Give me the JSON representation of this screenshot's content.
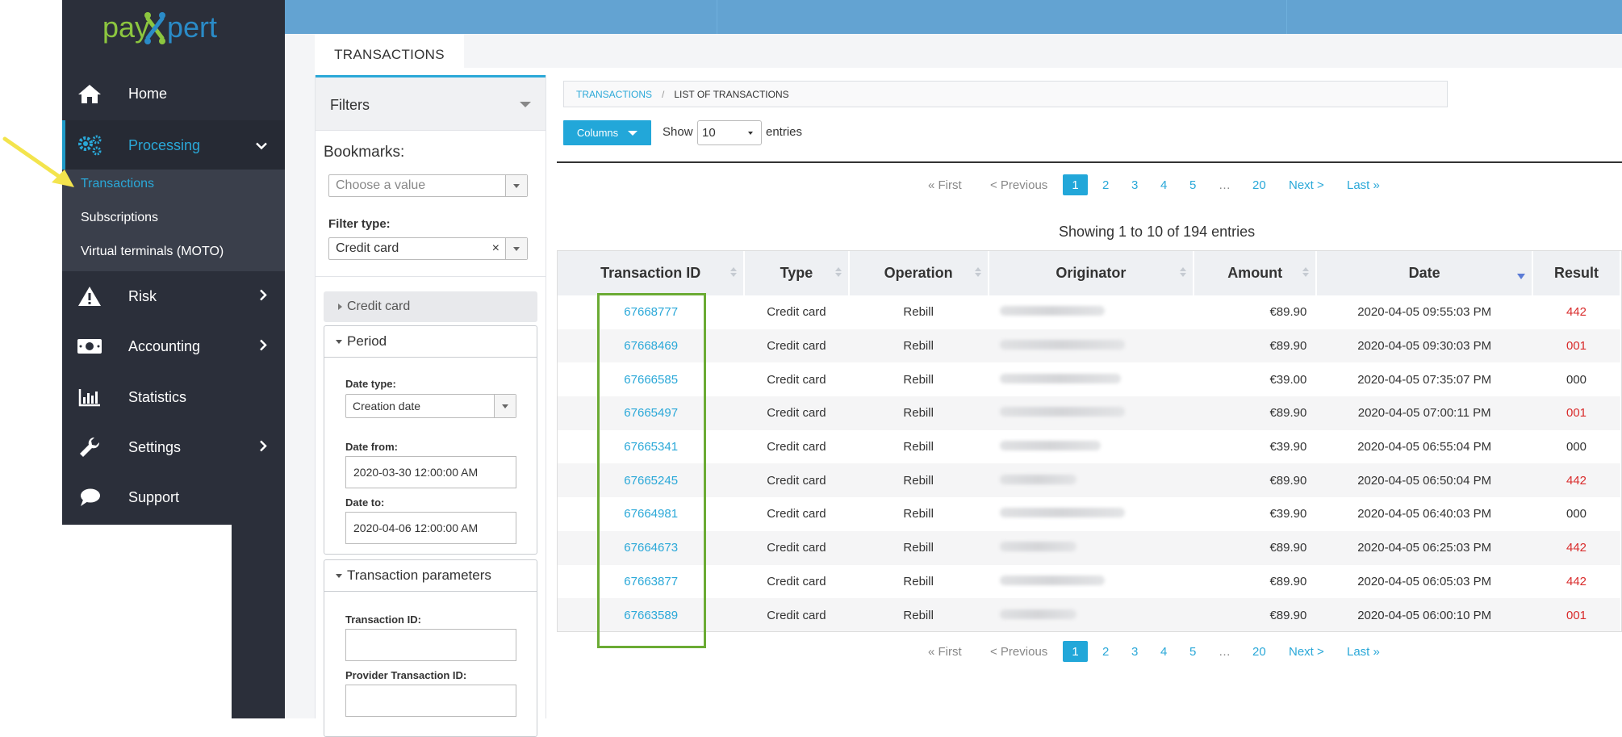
{
  "app": {
    "logo_text_left": "pay",
    "logo_text_right": "pert",
    "brand_colors": {
      "sidebar": "#2b2f3a",
      "accent": "#2aa8d8",
      "logo_blue": "#2a8bc7",
      "logo_green": "#8cc63f",
      "topbar": "#63a3d2"
    }
  },
  "sidebar": {
    "items": [
      {
        "label": "Home",
        "icon": "home-icon"
      },
      {
        "label": "Processing",
        "icon": "gears-icon",
        "expanded": true
      },
      {
        "label": "Risk",
        "icon": "warning-icon"
      },
      {
        "label": "Accounting",
        "icon": "money-icon"
      },
      {
        "label": "Statistics",
        "icon": "bar-chart-icon"
      },
      {
        "label": "Settings",
        "icon": "wrench-icon"
      },
      {
        "label": "Support",
        "icon": "chat-bubble-icon"
      }
    ],
    "sub_items": [
      {
        "label": "Transactions",
        "selected": true
      },
      {
        "label": "Subscriptions"
      },
      {
        "label": "Virtual terminals (MOTO)"
      }
    ]
  },
  "page": {
    "tab_title": "TRANSACTIONS"
  },
  "filters": {
    "title": "Filters",
    "bookmarks_label": "Bookmarks:",
    "bookmarks_placeholder": "Choose a value",
    "filter_type_label": "Filter type:",
    "filter_type_value": "Credit card",
    "credit_card_section": "Credit card",
    "period": {
      "title": "Period",
      "date_type_label": "Date type:",
      "date_type_value": "Creation date",
      "date_from_label": "Date from:",
      "date_from_value": "2020-03-30 12:00:00 AM",
      "date_to_label": "Date to:",
      "date_to_value": "2020-04-06 12:00:00 AM"
    },
    "transaction_parameters": {
      "title": "Transaction parameters",
      "transaction_id_label": "Transaction ID:",
      "transaction_id_value": "",
      "provider_transaction_id_label": "Provider Transaction ID:",
      "provider_transaction_id_value": ""
    }
  },
  "breadcrumb": {
    "link": "TRANSACTIONS",
    "separator": "/",
    "current": "LIST OF TRANSACTIONS"
  },
  "toolbar": {
    "columns_label": "Columns",
    "show_label": "Show",
    "page_size": "10",
    "entries_label": "entries"
  },
  "pagination": {
    "first": "« First",
    "previous": "< Previous",
    "pages": [
      "1",
      "2",
      "3",
      "4",
      "5"
    ],
    "active_page": "1",
    "ellipsis": "…",
    "last_page": "20",
    "next": "Next >",
    "last": "Last »"
  },
  "summary": {
    "text": "Showing 1 to 10 of 194 entries"
  },
  "table": {
    "headers": [
      "Transaction ID",
      "Type",
      "Operation",
      "Originator",
      "Amount",
      "Date",
      "Result"
    ],
    "rows": [
      {
        "id": "67668777",
        "type": "Credit card",
        "operation": "Rebill",
        "amount": "€89.90",
        "date": "2020-04-05 09:55:03 PM",
        "result": "442",
        "result_color": "red"
      },
      {
        "id": "67668469",
        "type": "Credit card",
        "operation": "Rebill",
        "amount": "€89.90",
        "date": "2020-04-05 09:30:03 PM",
        "result": "001",
        "result_color": "red"
      },
      {
        "id": "67666585",
        "type": "Credit card",
        "operation": "Rebill",
        "amount": "€39.00",
        "date": "2020-04-05 07:35:07 PM",
        "result": "000",
        "result_color": "normal"
      },
      {
        "id": "67665497",
        "type": "Credit card",
        "operation": "Rebill",
        "amount": "€89.90",
        "date": "2020-04-05 07:00:11 PM",
        "result": "001",
        "result_color": "red"
      },
      {
        "id": "67665341",
        "type": "Credit card",
        "operation": "Rebill",
        "amount": "€39.90",
        "date": "2020-04-05 06:55:04 PM",
        "result": "000",
        "result_color": "normal"
      },
      {
        "id": "67665245",
        "type": "Credit card",
        "operation": "Rebill",
        "amount": "€89.90",
        "date": "2020-04-05 06:50:04 PM",
        "result": "442",
        "result_color": "red"
      },
      {
        "id": "67664981",
        "type": "Credit card",
        "operation": "Rebill",
        "amount": "€39.90",
        "date": "2020-04-05 06:40:03 PM",
        "result": "000",
        "result_color": "normal"
      },
      {
        "id": "67664673",
        "type": "Credit card",
        "operation": "Rebill",
        "amount": "€89.90",
        "date": "2020-04-05 06:25:03 PM",
        "result": "442",
        "result_color": "red"
      },
      {
        "id": "67663877",
        "type": "Credit card",
        "operation": "Rebill",
        "amount": "€89.90",
        "date": "2020-04-05 06:05:03 PM",
        "result": "442",
        "result_color": "red"
      },
      {
        "id": "67663589",
        "type": "Credit card",
        "operation": "Rebill",
        "amount": "€89.90",
        "date": "2020-04-05 06:00:10 PM",
        "result": "001",
        "result_color": "red"
      }
    ]
  }
}
